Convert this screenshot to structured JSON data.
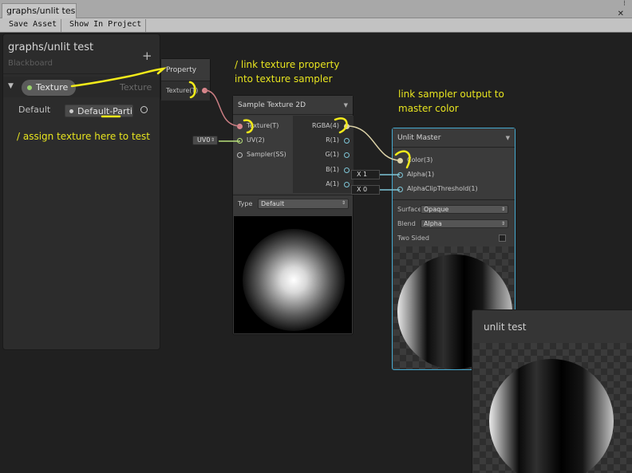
{
  "window": {
    "tab_title": "graphs/unlit tes",
    "menu_icon": "kebab-menu-icon",
    "close_icon": "close-icon"
  },
  "toolbar": {
    "save_asset": "Save Asset",
    "show_in_project": "Show In Project"
  },
  "blackboard": {
    "title": "graphs/unlit test",
    "subtitle": "Blackboard",
    "add_symbol": "+",
    "property": {
      "name": "Texture",
      "type": "Texture",
      "default_label": "Default",
      "default_value": "Default-Partic"
    }
  },
  "property_node": {
    "title": "Property",
    "output_label": "Texture(T)"
  },
  "uv_input": {
    "value": "UV0"
  },
  "sample_node": {
    "title": "Sample Texture 2D",
    "inputs": [
      "Texture(T)",
      "UV(2)",
      "Sampler(SS)"
    ],
    "outputs": [
      "RGBA(4)",
      "R(1)",
      "G(1)",
      "B(1)",
      "A(1)"
    ],
    "type_label": "Type",
    "type_value": "Default"
  },
  "alpha_inputs": {
    "alpha": "X 1",
    "alpha_clip": "X 0"
  },
  "master_node": {
    "title": "Unlit Master",
    "inputs": [
      "Color(3)",
      "Alpha(1)",
      "AlphaClipThreshold(1)"
    ],
    "surface_label": "Surface",
    "surface_value": "Opaque",
    "blend_label": "Blend",
    "blend_value": "Alpha",
    "two_sided_label": "Two Sided"
  },
  "preview_window": {
    "title": "unlit test"
  },
  "annotations": {
    "link_texture_1": "/ link texture property",
    "link_texture_2": "into texture sampler",
    "link_sampler_1": "link sampler output to",
    "link_sampler_2": "master color",
    "assign_texture": "/ assign texture here to test"
  },
  "colors": {
    "accent_blue": "#44a9cf",
    "annotation_yellow": "#e7e41f",
    "texture_edge": "#c97d82",
    "color_edge": "#ddd3a8",
    "vector2_edge": "#b8e07a",
    "float_edge": "#7ec6d8"
  }
}
